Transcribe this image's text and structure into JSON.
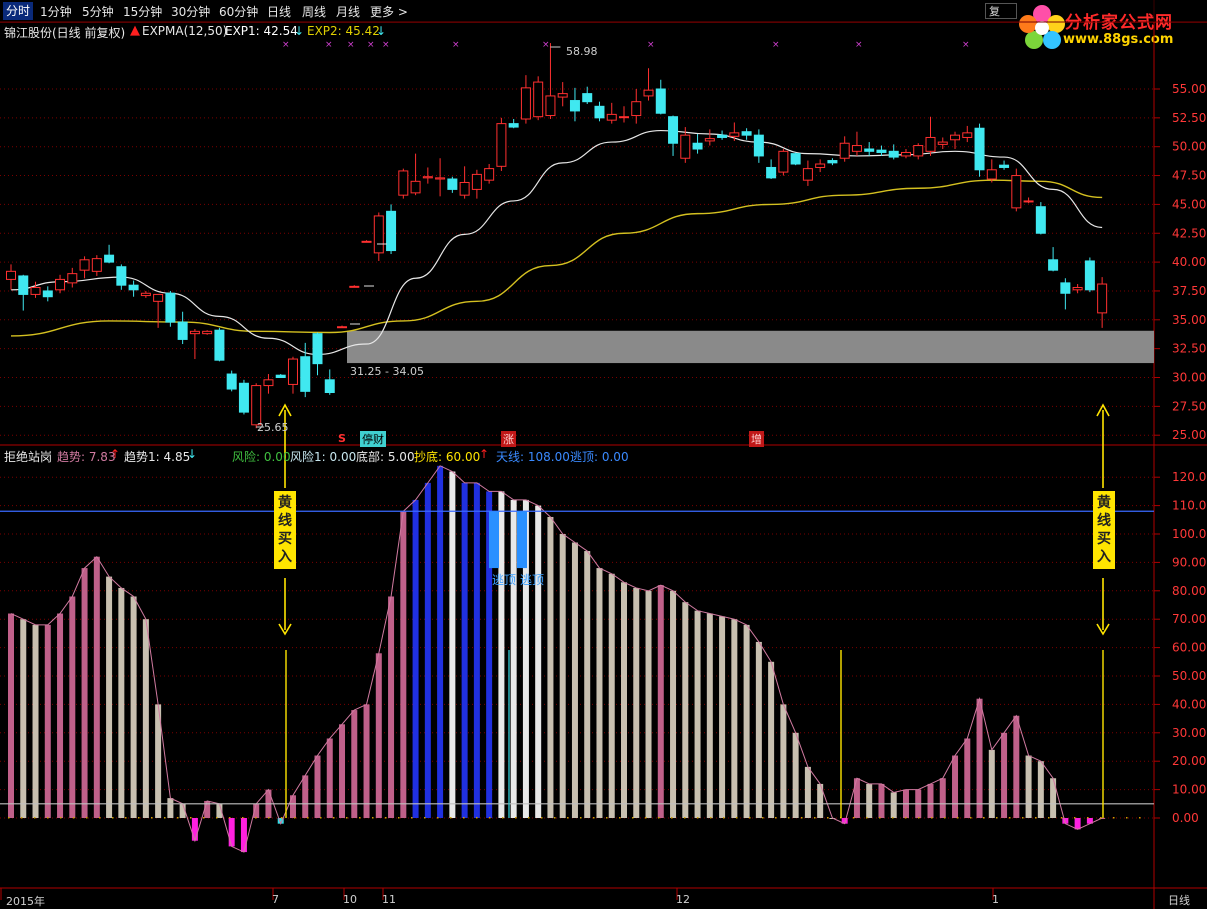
{
  "toolbar": {
    "tabs": [
      "分时",
      "1分钟",
      "5分钟",
      "15分钟",
      "30分钟",
      "60分钟",
      "日线",
      "周线",
      "月线",
      "更多 >"
    ],
    "restore_label": "复"
  },
  "logo": {
    "title": "分析家公式网",
    "url": "www.88gs.com"
  },
  "main_legend": {
    "stock": "锦江股份(日线 前复权)",
    "indicator": "EXPMA(12,50)",
    "exp1": "EXP1: 42.54",
    "exp2": "EXP2: 45.42"
  },
  "main_annotations": {
    "high_label": "58.98",
    "low_label": "25.65",
    "zone_label": "31.25 - 34.05"
  },
  "events": {
    "s": "S",
    "tingcai": "停财",
    "zhang": "涨",
    "zeng": "增"
  },
  "sub_legend": {
    "name": "拒绝站岗",
    "trend": "趋势: 7.83",
    "trend1": "趋势1: 4.85",
    "risk": "风险: 0.00",
    "risk1": "风险1: 0.00",
    "bottom": "底部: 5.00",
    "chaodi": "抄底: 60.00",
    "tianxian": "天线: 108.00",
    "taoding": "逃顶: 0.00"
  },
  "signals": {
    "buy_left": "黄线买入",
    "buy_right": "黄线买入",
    "escape1": "逃顶",
    "escape2": "逃顶"
  },
  "price_axis": [
    "55.00",
    "52.50",
    "50.00",
    "47.50",
    "45.00",
    "42.50",
    "40.00",
    "37.50",
    "35.00",
    "32.50",
    "30.00",
    "27.50",
    "25.00"
  ],
  "ind_axis": [
    "120.0",
    "110.0",
    "100.0",
    "90.00",
    "80.00",
    "70.00",
    "60.00",
    "50.00",
    "40.00",
    "30.00",
    "20.00",
    "10.00",
    "0.00"
  ],
  "date_axis": {
    "year": "2015年",
    "d7": "7",
    "d10": "10",
    "d11": "11",
    "d12": "12",
    "d1": "1"
  },
  "period_label": "日线",
  "colors": {
    "up": "#ff3030",
    "down": "#40e8f0",
    "exp1": "#e6e6e6",
    "exp2": "#d4c020",
    "grid": "#7a0000",
    "signal": "#ffe500"
  },
  "chart_data": [
    {
      "type": "candlestick",
      "title": "锦江股份(日线 前复权)",
      "candles_ohlc": [
        [
          38.5,
          39.8,
          37.6,
          39.2
        ],
        [
          38.8,
          38.9,
          35.8,
          37.2
        ],
        [
          37.2,
          38.3,
          36.9,
          37.8
        ],
        [
          37.5,
          37.9,
          36.6,
          37.0
        ],
        [
          37.6,
          38.9,
          37.3,
          38.5
        ],
        [
          38.2,
          39.5,
          37.8,
          39.0
        ],
        [
          39.3,
          40.5,
          38.6,
          40.2
        ],
        [
          39.2,
          40.6,
          38.8,
          40.3
        ],
        [
          40.6,
          41.5,
          39.9,
          40.0
        ],
        [
          39.6,
          39.8,
          37.6,
          38.0
        ],
        [
          38.0,
          38.4,
          37.0,
          37.6
        ],
        [
          37.1,
          37.5,
          36.9,
          37.3
        ],
        [
          36.6,
          37.0,
          34.3,
          37.2
        ],
        [
          37.3,
          37.5,
          34.4,
          34.8
        ],
        [
          34.8,
          35.7,
          32.9,
          33.3
        ],
        [
          33.8,
          34.2,
          31.6,
          34.0
        ],
        [
          33.8,
          34.1,
          33.7,
          34.0
        ],
        [
          34.1,
          34.3,
          31.4,
          31.5
        ],
        [
          30.3,
          30.6,
          28.8,
          29.0
        ],
        [
          29.5,
          29.8,
          26.8,
          27.0
        ],
        [
          25.9,
          29.5,
          25.6,
          29.3
        ],
        [
          29.3,
          30.3,
          28.6,
          29.8
        ],
        [
          30.2,
          30.3,
          30.0,
          30.0
        ],
        [
          29.4,
          31.8,
          28.6,
          31.6
        ],
        [
          31.8,
          33.0,
          28.3,
          28.8
        ],
        [
          33.8,
          33.9,
          30.2,
          31.2
        ],
        [
          29.8,
          30.7,
          28.5,
          28.7
        ],
        [
          34.4,
          34.5,
          34.3,
          34.4
        ],
        [
          37.9,
          38.0,
          37.8,
          37.9
        ],
        [
          41.8,
          41.9,
          41.7,
          41.8
        ],
        [
          40.8,
          44.3,
          40.1,
          44.0
        ],
        [
          44.4,
          45.0,
          40.7,
          41.0
        ],
        [
          45.8,
          48.1,
          45.5,
          47.9
        ],
        [
          46.0,
          49.4,
          45.8,
          47.0
        ],
        [
          47.3,
          48.2,
          46.8,
          47.4
        ],
        [
          47.2,
          49.0,
          45.7,
          47.3
        ],
        [
          47.2,
          47.4,
          46.0,
          46.3
        ],
        [
          45.8,
          48.3,
          45.5,
          46.9
        ],
        [
          46.3,
          48.0,
          45.5,
          47.6
        ],
        [
          47.1,
          48.5,
          46.8,
          48.1
        ],
        [
          48.3,
          52.5,
          47.9,
          52.0
        ],
        [
          52.0,
          52.4,
          51.6,
          51.7
        ],
        [
          52.4,
          56.2,
          52.0,
          55.1
        ],
        [
          52.6,
          56.1,
          52.3,
          55.6
        ],
        [
          52.7,
          58.98,
          52.4,
          54.4
        ],
        [
          54.3,
          55.6,
          53.5,
          54.6
        ],
        [
          54.0,
          55.1,
          52.2,
          53.1
        ],
        [
          54.6,
          55.2,
          53.7,
          53.9
        ],
        [
          53.5,
          53.9,
          52.2,
          52.5
        ],
        [
          52.3,
          53.8,
          52.0,
          52.8
        ],
        [
          52.6,
          53.5,
          52.1,
          52.6
        ],
        [
          52.7,
          55.0,
          52.0,
          53.9
        ],
        [
          54.4,
          56.8,
          54.0,
          54.9
        ],
        [
          55.0,
          55.8,
          52.8,
          52.9
        ],
        [
          52.6,
          52.7,
          49.2,
          50.3
        ],
        [
          49.0,
          51.7,
          48.6,
          51.0
        ],
        [
          50.3,
          51.1,
          49.4,
          49.8
        ],
        [
          50.5,
          51.5,
          50.1,
          50.7
        ],
        [
          51.0,
          51.4,
          50.6,
          50.8
        ],
        [
          50.9,
          52.1,
          50.5,
          51.2
        ],
        [
          51.3,
          51.6,
          50.6,
          51.0
        ],
        [
          51.0,
          51.5,
          48.6,
          49.2
        ],
        [
          48.2,
          48.9,
          47.2,
          47.3
        ],
        [
          47.8,
          49.8,
          47.5,
          49.6
        ],
        [
          49.4,
          49.5,
          48.4,
          48.5
        ],
        [
          47.1,
          48.8,
          46.6,
          48.1
        ],
        [
          48.2,
          48.9,
          47.8,
          48.5
        ],
        [
          48.8,
          49.0,
          48.4,
          48.6
        ],
        [
          49.0,
          50.9,
          48.7,
          50.3
        ],
        [
          49.6,
          51.3,
          49.2,
          50.1
        ],
        [
          49.8,
          50.4,
          49.2,
          49.6
        ],
        [
          49.7,
          50.1,
          49.2,
          49.5
        ],
        [
          49.6,
          50.2,
          48.9,
          49.1
        ],
        [
          49.2,
          49.8,
          49.0,
          49.5
        ],
        [
          49.2,
          50.3,
          48.9,
          50.1
        ],
        [
          49.6,
          52.6,
          49.2,
          50.8
        ],
        [
          50.2,
          50.8,
          49.8,
          50.4
        ],
        [
          50.6,
          51.3,
          49.8,
          51.0
        ],
        [
          50.8,
          51.8,
          50.4,
          51.2
        ],
        [
          51.6,
          52.0,
          47.4,
          48.0
        ],
        [
          47.2,
          48.9,
          46.9,
          48.0
        ],
        [
          48.4,
          48.8,
          48.0,
          48.2
        ],
        [
          44.7,
          48.1,
          44.4,
          47.5
        ],
        [
          45.3,
          45.6,
          45.1,
          45.3
        ],
        [
          44.8,
          45.2,
          42.4,
          42.5
        ],
        [
          40.2,
          41.3,
          39.2,
          39.3
        ],
        [
          38.2,
          38.6,
          35.9,
          37.3
        ],
        [
          37.6,
          38.1,
          37.3,
          37.8
        ],
        [
          40.1,
          40.4,
          37.4,
          37.6
        ],
        [
          35.6,
          38.7,
          34.3,
          38.1
        ]
      ],
      "exp1_approx": [
        [
          0,
          37.6
        ],
        [
          4,
          38.3
        ],
        [
          9,
          38.7
        ],
        [
          13,
          37.3
        ],
        [
          17,
          35.3
        ],
        [
          21,
          33.4
        ],
        [
          25,
          32.0
        ],
        [
          29,
          32.9
        ],
        [
          33,
          38.6
        ],
        [
          37,
          42.4
        ],
        [
          41,
          45.3
        ],
        [
          45,
          48.6
        ],
        [
          49,
          50.4
        ],
        [
          53,
          51.4
        ],
        [
          57,
          51.1
        ],
        [
          61,
          50.4
        ],
        [
          65,
          49.4
        ],
        [
          69,
          49.2
        ],
        [
          73,
          49.3
        ],
        [
          77,
          49.6
        ],
        [
          81,
          49.1
        ],
        [
          85,
          46.3
        ],
        [
          89,
          43.0
        ]
      ],
      "exp2_approx": [
        [
          0,
          33.6
        ],
        [
          8,
          34.9
        ],
        [
          14,
          34.8
        ],
        [
          20,
          34.0
        ],
        [
          26,
          33.9
        ],
        [
          32,
          34.9
        ],
        [
          38,
          36.6
        ],
        [
          44,
          39.7
        ],
        [
          50,
          42.5
        ],
        [
          56,
          44.2
        ],
        [
          62,
          45.0
        ],
        [
          68,
          45.8
        ],
        [
          74,
          46.4
        ],
        [
          80,
          47.1
        ],
        [
          84,
          47.0
        ],
        [
          89,
          45.6
        ]
      ],
      "zone_range": [
        31.25,
        34.05
      ],
      "high": 58.98,
      "low": 25.65,
      "ylim": [
        24.5,
        59.5
      ]
    },
    {
      "type": "bar",
      "title": "拒绝站岗",
      "values": [
        72,
        70,
        68,
        68,
        72,
        78,
        88,
        92,
        85,
        81,
        78,
        70,
        40,
        7,
        5,
        -8,
        6,
        5,
        -10,
        -12,
        5,
        10,
        -2,
        8,
        15,
        22,
        28,
        33,
        38,
        40,
        58,
        78,
        108,
        112,
        118,
        124,
        122,
        118,
        118,
        115,
        115,
        112,
        112,
        110,
        106,
        100,
        97,
        94,
        88,
        86,
        83,
        81,
        80,
        82,
        80,
        76,
        73,
        72,
        71,
        70,
        68,
        62,
        55,
        40,
        30,
        18,
        12,
        0,
        -2,
        14,
        12,
        12,
        9,
        10,
        10,
        12,
        14,
        22,
        28,
        42,
        24,
        30,
        36,
        22,
        20,
        14,
        -2,
        -4,
        -2,
        0
      ],
      "tianxian": 108,
      "bottom": 5,
      "ylim": [
        -12,
        130
      ]
    }
  ]
}
